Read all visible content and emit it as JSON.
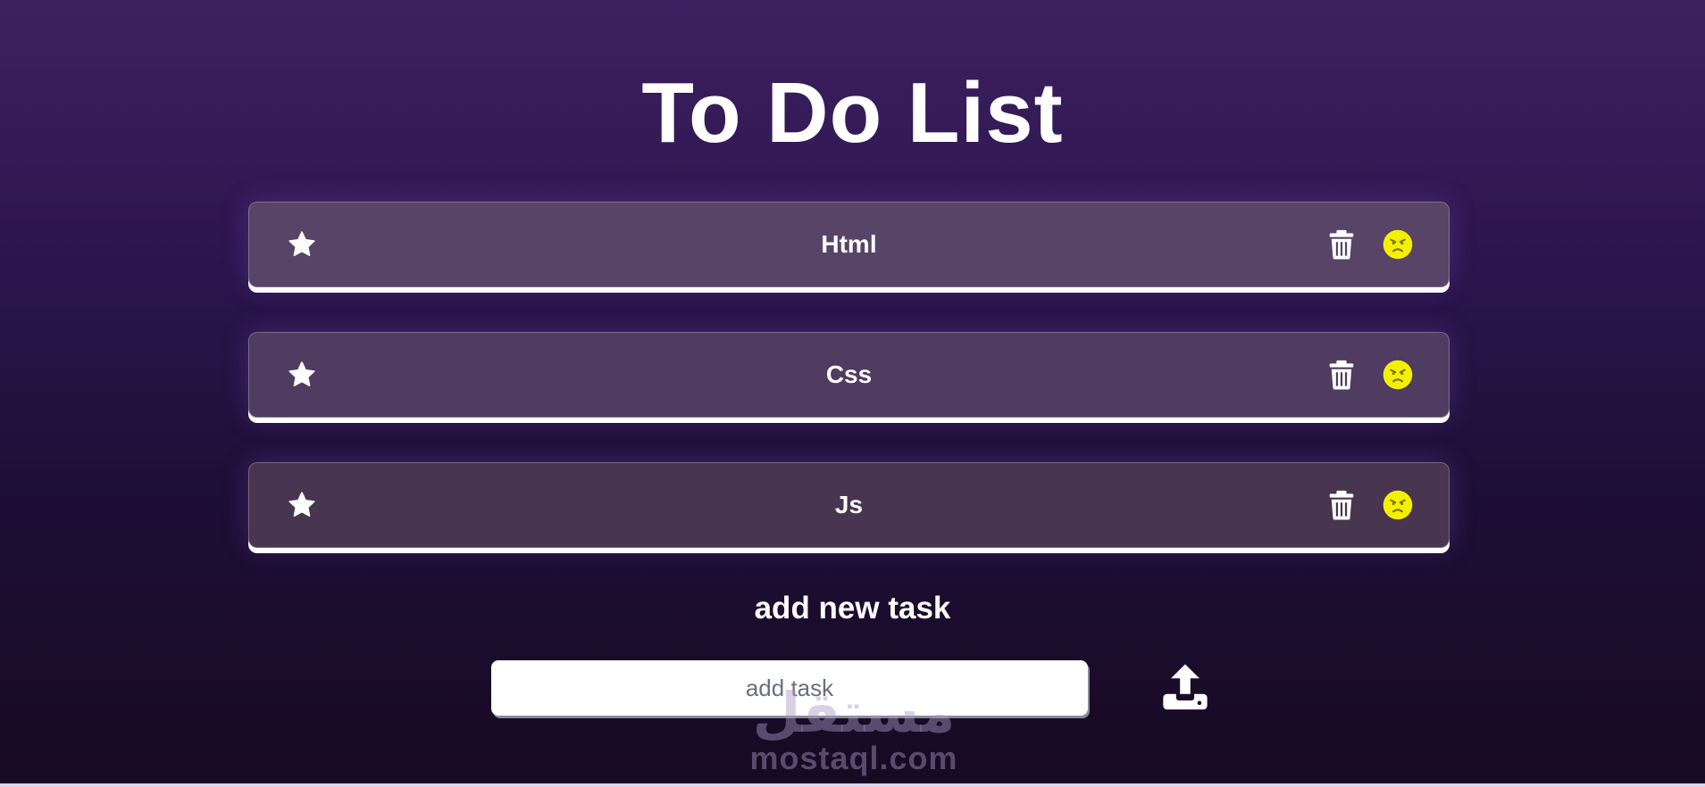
{
  "header": {
    "title": "To Do List"
  },
  "tasks": [
    {
      "label": "Html",
      "star_icon": "star-icon",
      "delete_icon": "trash-icon",
      "status_icon": "angry-face-icon"
    },
    {
      "label": "Css",
      "star_icon": "star-icon",
      "delete_icon": "trash-icon",
      "status_icon": "angry-face-icon"
    },
    {
      "label": "Js",
      "star_icon": "star-icon",
      "delete_icon": "trash-icon",
      "status_icon": "angry-face-icon"
    }
  ],
  "add_section": {
    "heading": "add new task",
    "input_placeholder": "add task",
    "input_value": "",
    "submit_icon": "upload-icon"
  },
  "watermark": {
    "arabic": "مستقل",
    "latin": "mostaql.com"
  },
  "colors": {
    "accent_yellow": "#f5f000",
    "text": "#ffffff",
    "bg_top": "#3d2061",
    "bg_bottom": "#170a22"
  }
}
